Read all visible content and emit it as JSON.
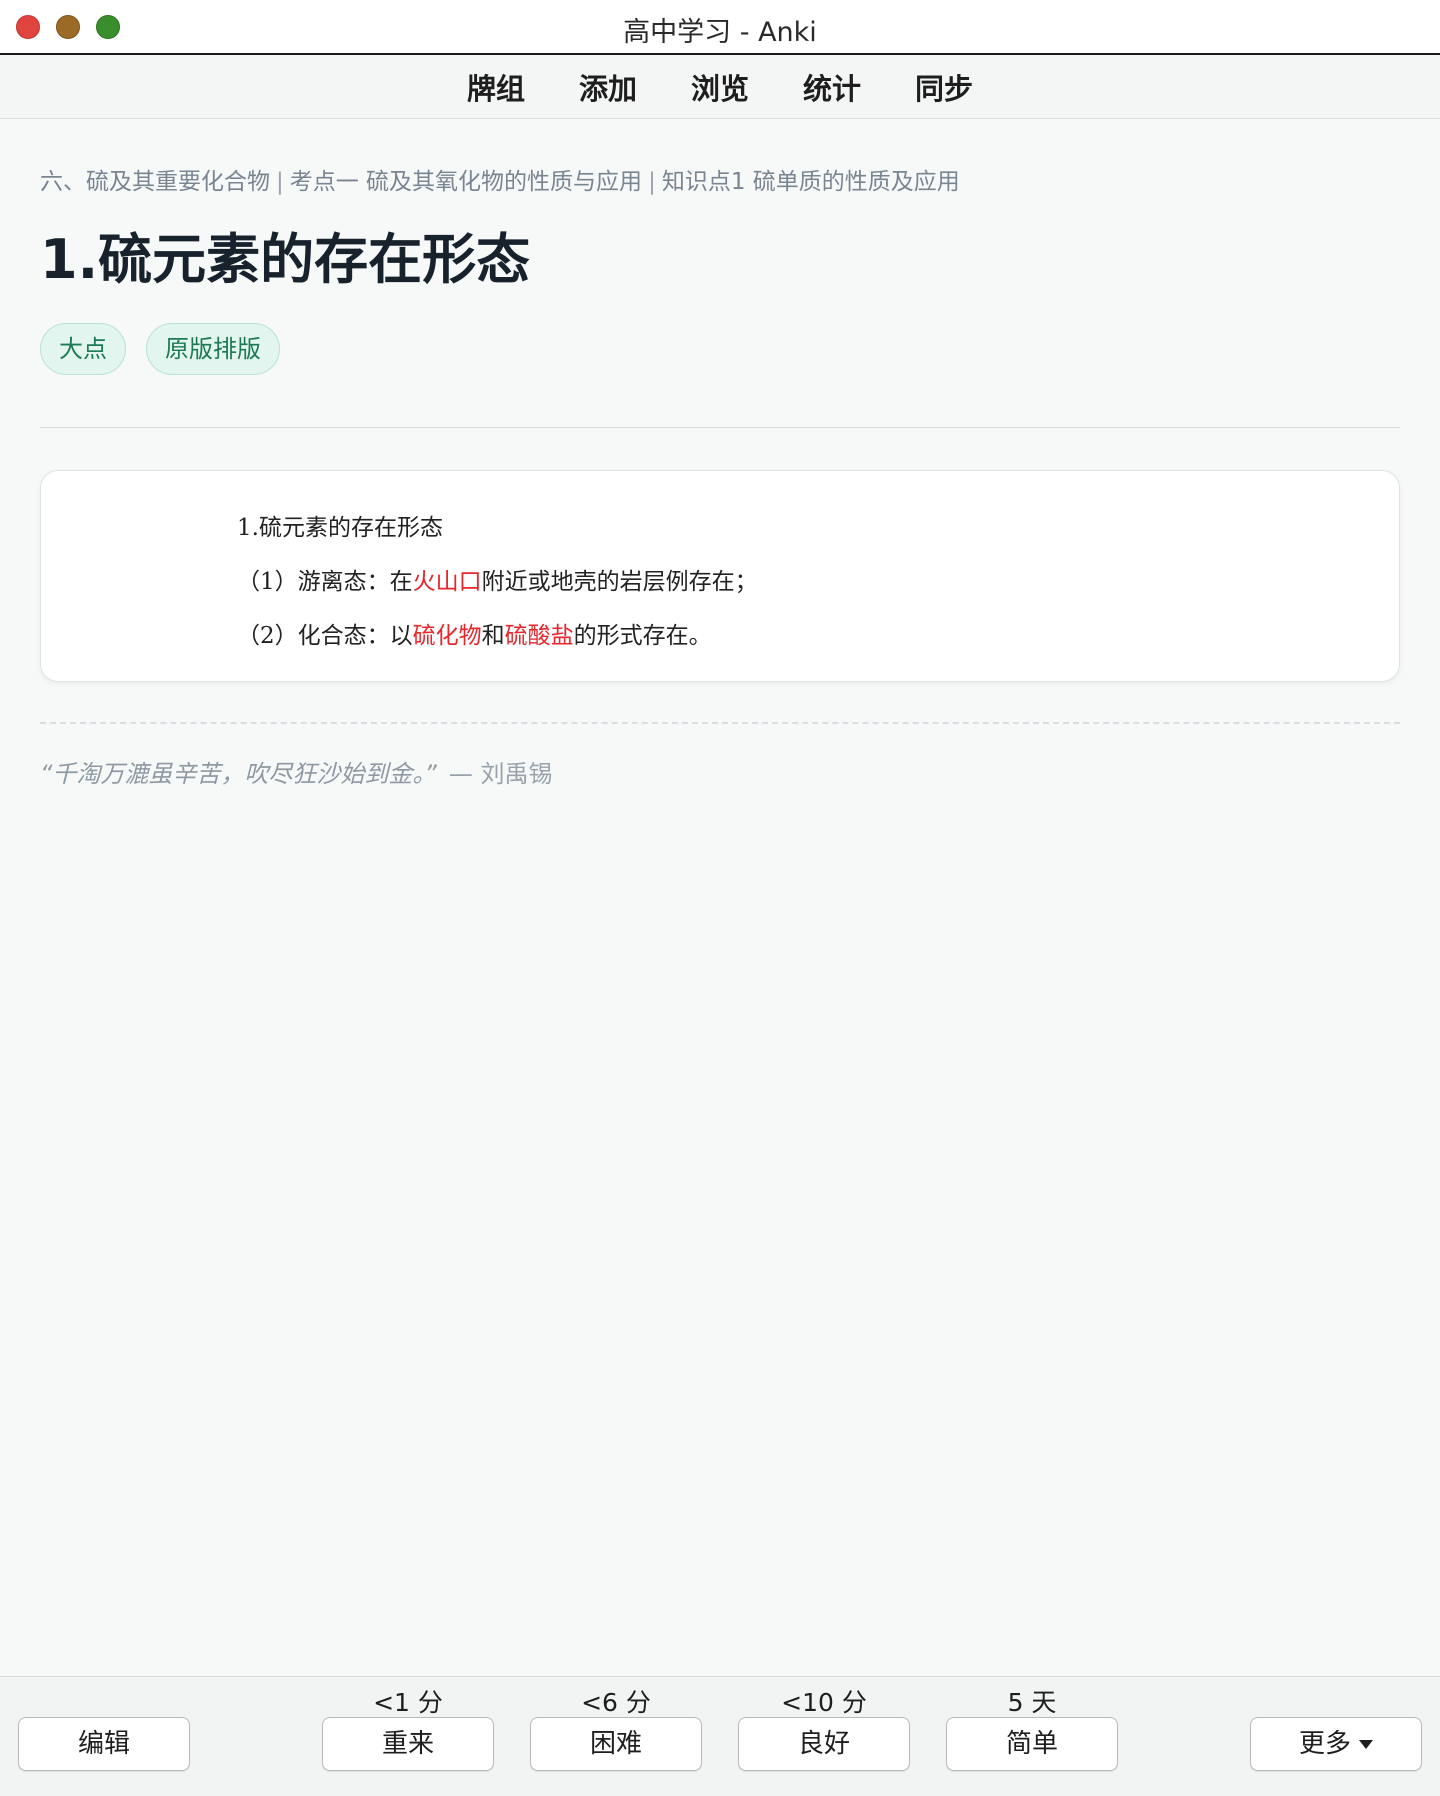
{
  "window": {
    "title": "高中学习 - Anki"
  },
  "topnav": {
    "items": [
      "牌组",
      "添加",
      "浏览",
      "统计",
      "同步"
    ]
  },
  "card": {
    "breadcrumb": [
      "六、硫及其重要化合物",
      "考点一 硫及其氧化物的性质与应用",
      "知识点1 硫单质的性质及应用"
    ],
    "breadcrumb_separator": "|",
    "title": "1.硫元素的存在形态",
    "tags": [
      "大点",
      "原版排版"
    ],
    "content": {
      "line1": "1.硫元素的存在形态",
      "line2": {
        "prefix": "（1）游离态：在",
        "highlight": "火山口",
        "suffix": "附近或地壳的岩层例存在；"
      },
      "line3": {
        "prefix": "（2）化合态：以",
        "highlight1": "硫化物",
        "middle": "和",
        "highlight2": "硫酸盐",
        "suffix": "的形式存在。"
      },
      "highlight_color": "#e8262b"
    },
    "quote": {
      "text": "“千淘万漉虽辛苦，吹尽狂沙始到金。”",
      "author": "— 刘禹锡"
    }
  },
  "bottombar": {
    "edit_label": "编辑",
    "more_label": "更多",
    "answers": [
      {
        "label": "重来",
        "interval": "<1 分"
      },
      {
        "label": "困难",
        "interval": "<6 分"
      },
      {
        "label": "良好",
        "interval": "<10 分"
      },
      {
        "label": "简单",
        "interval": "5 天"
      }
    ]
  },
  "colors": {
    "tag_bg": "#e2f5ee",
    "tag_text": "#1d7a55",
    "traffic_close": "#e0443e",
    "traffic_min": "#9a6a26",
    "traffic_max": "#3a8d2d"
  }
}
